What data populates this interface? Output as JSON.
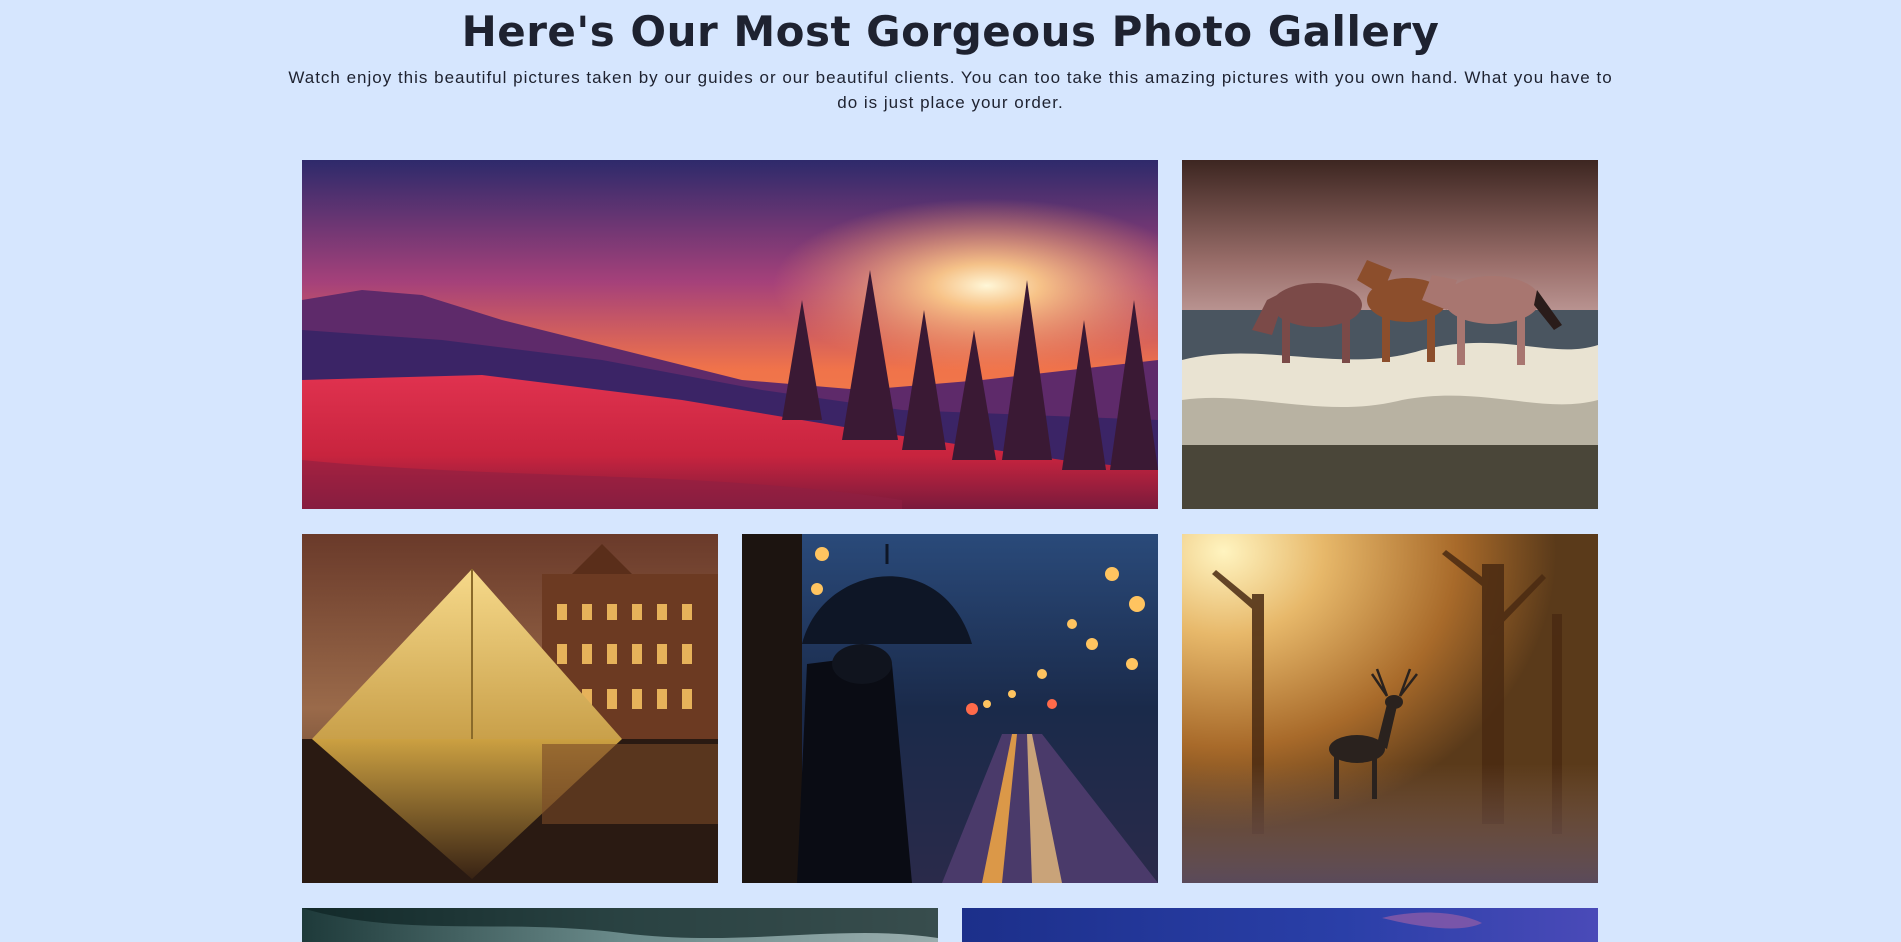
{
  "header": {
    "title": "Here's Our Most Gorgeous Photo Gallery",
    "subtitle": "Watch enjoy this beautiful pictures taken by our guides or our beautiful clients. You can too take this amazing pictures with you own hand. What you have to do is just place your order."
  },
  "colors": {
    "page_background": "#d6e6fe",
    "text": "#1e2230"
  }
}
